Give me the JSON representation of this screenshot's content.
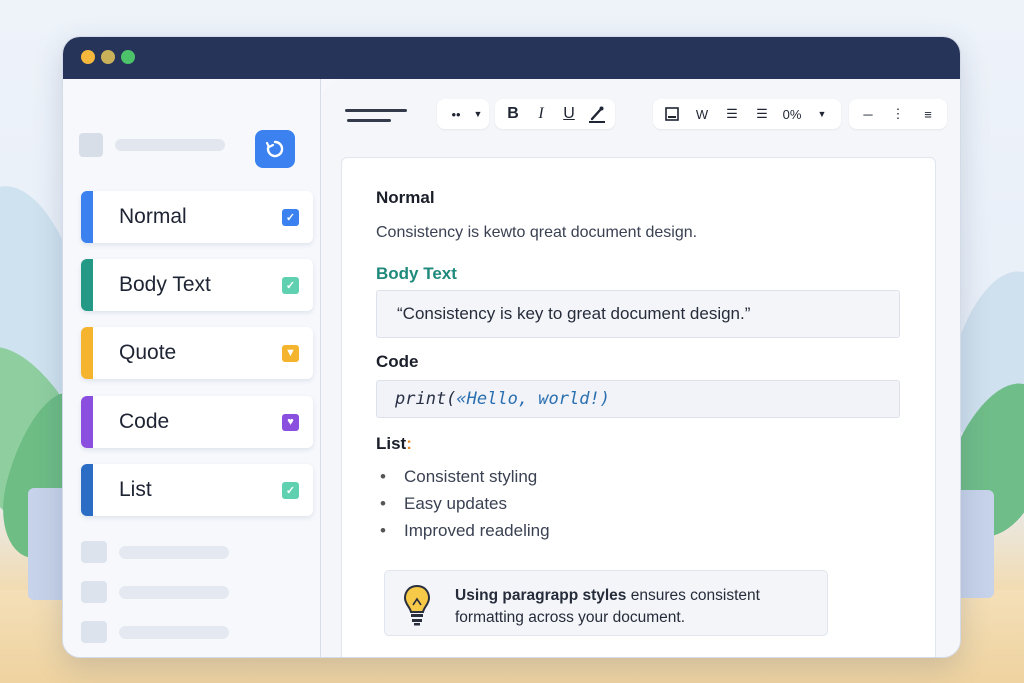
{
  "window": {
    "controls": [
      "close",
      "minimize",
      "maximize"
    ]
  },
  "sidebar": {
    "action_icon": "refresh-icon",
    "styles": [
      {
        "label": "Normal",
        "color": "#3b82f0",
        "check_color": "#3b82f0"
      },
      {
        "label": "Body Text",
        "color": "#249a86",
        "check_color": "#5fd0b0"
      },
      {
        "label": "Quote",
        "color": "#f5b42e",
        "check_color": "#f5b42e"
      },
      {
        "label": "Code",
        "color": "#8b4fe0",
        "check_color": "#8b4fe0"
      },
      {
        "label": "List",
        "color": "#2b6cc4",
        "check_color": "#5fd0b0"
      }
    ]
  },
  "toolbar": {
    "more": "••",
    "bold": "B",
    "italic": "I",
    "underline": "U",
    "w_button": "W",
    "percent": "0%"
  },
  "document": {
    "normal_heading": "Normal",
    "normal_text": "Consistency is kewto qreat document design.",
    "body_heading": "Body Text",
    "quote_text": "“Consistency is key to great document design.”",
    "code_heading": "Code",
    "code_fn": "print(",
    "code_str": "«Hello, world!)",
    "list_heading": "List",
    "list_colon": ":",
    "list_items": [
      "Consistent styling",
      "Easy updates",
      "Improved readeling"
    ],
    "tip_bold": "Using paragrapp styles",
    "tip_rest": " ensures consistent formatting across your document."
  }
}
